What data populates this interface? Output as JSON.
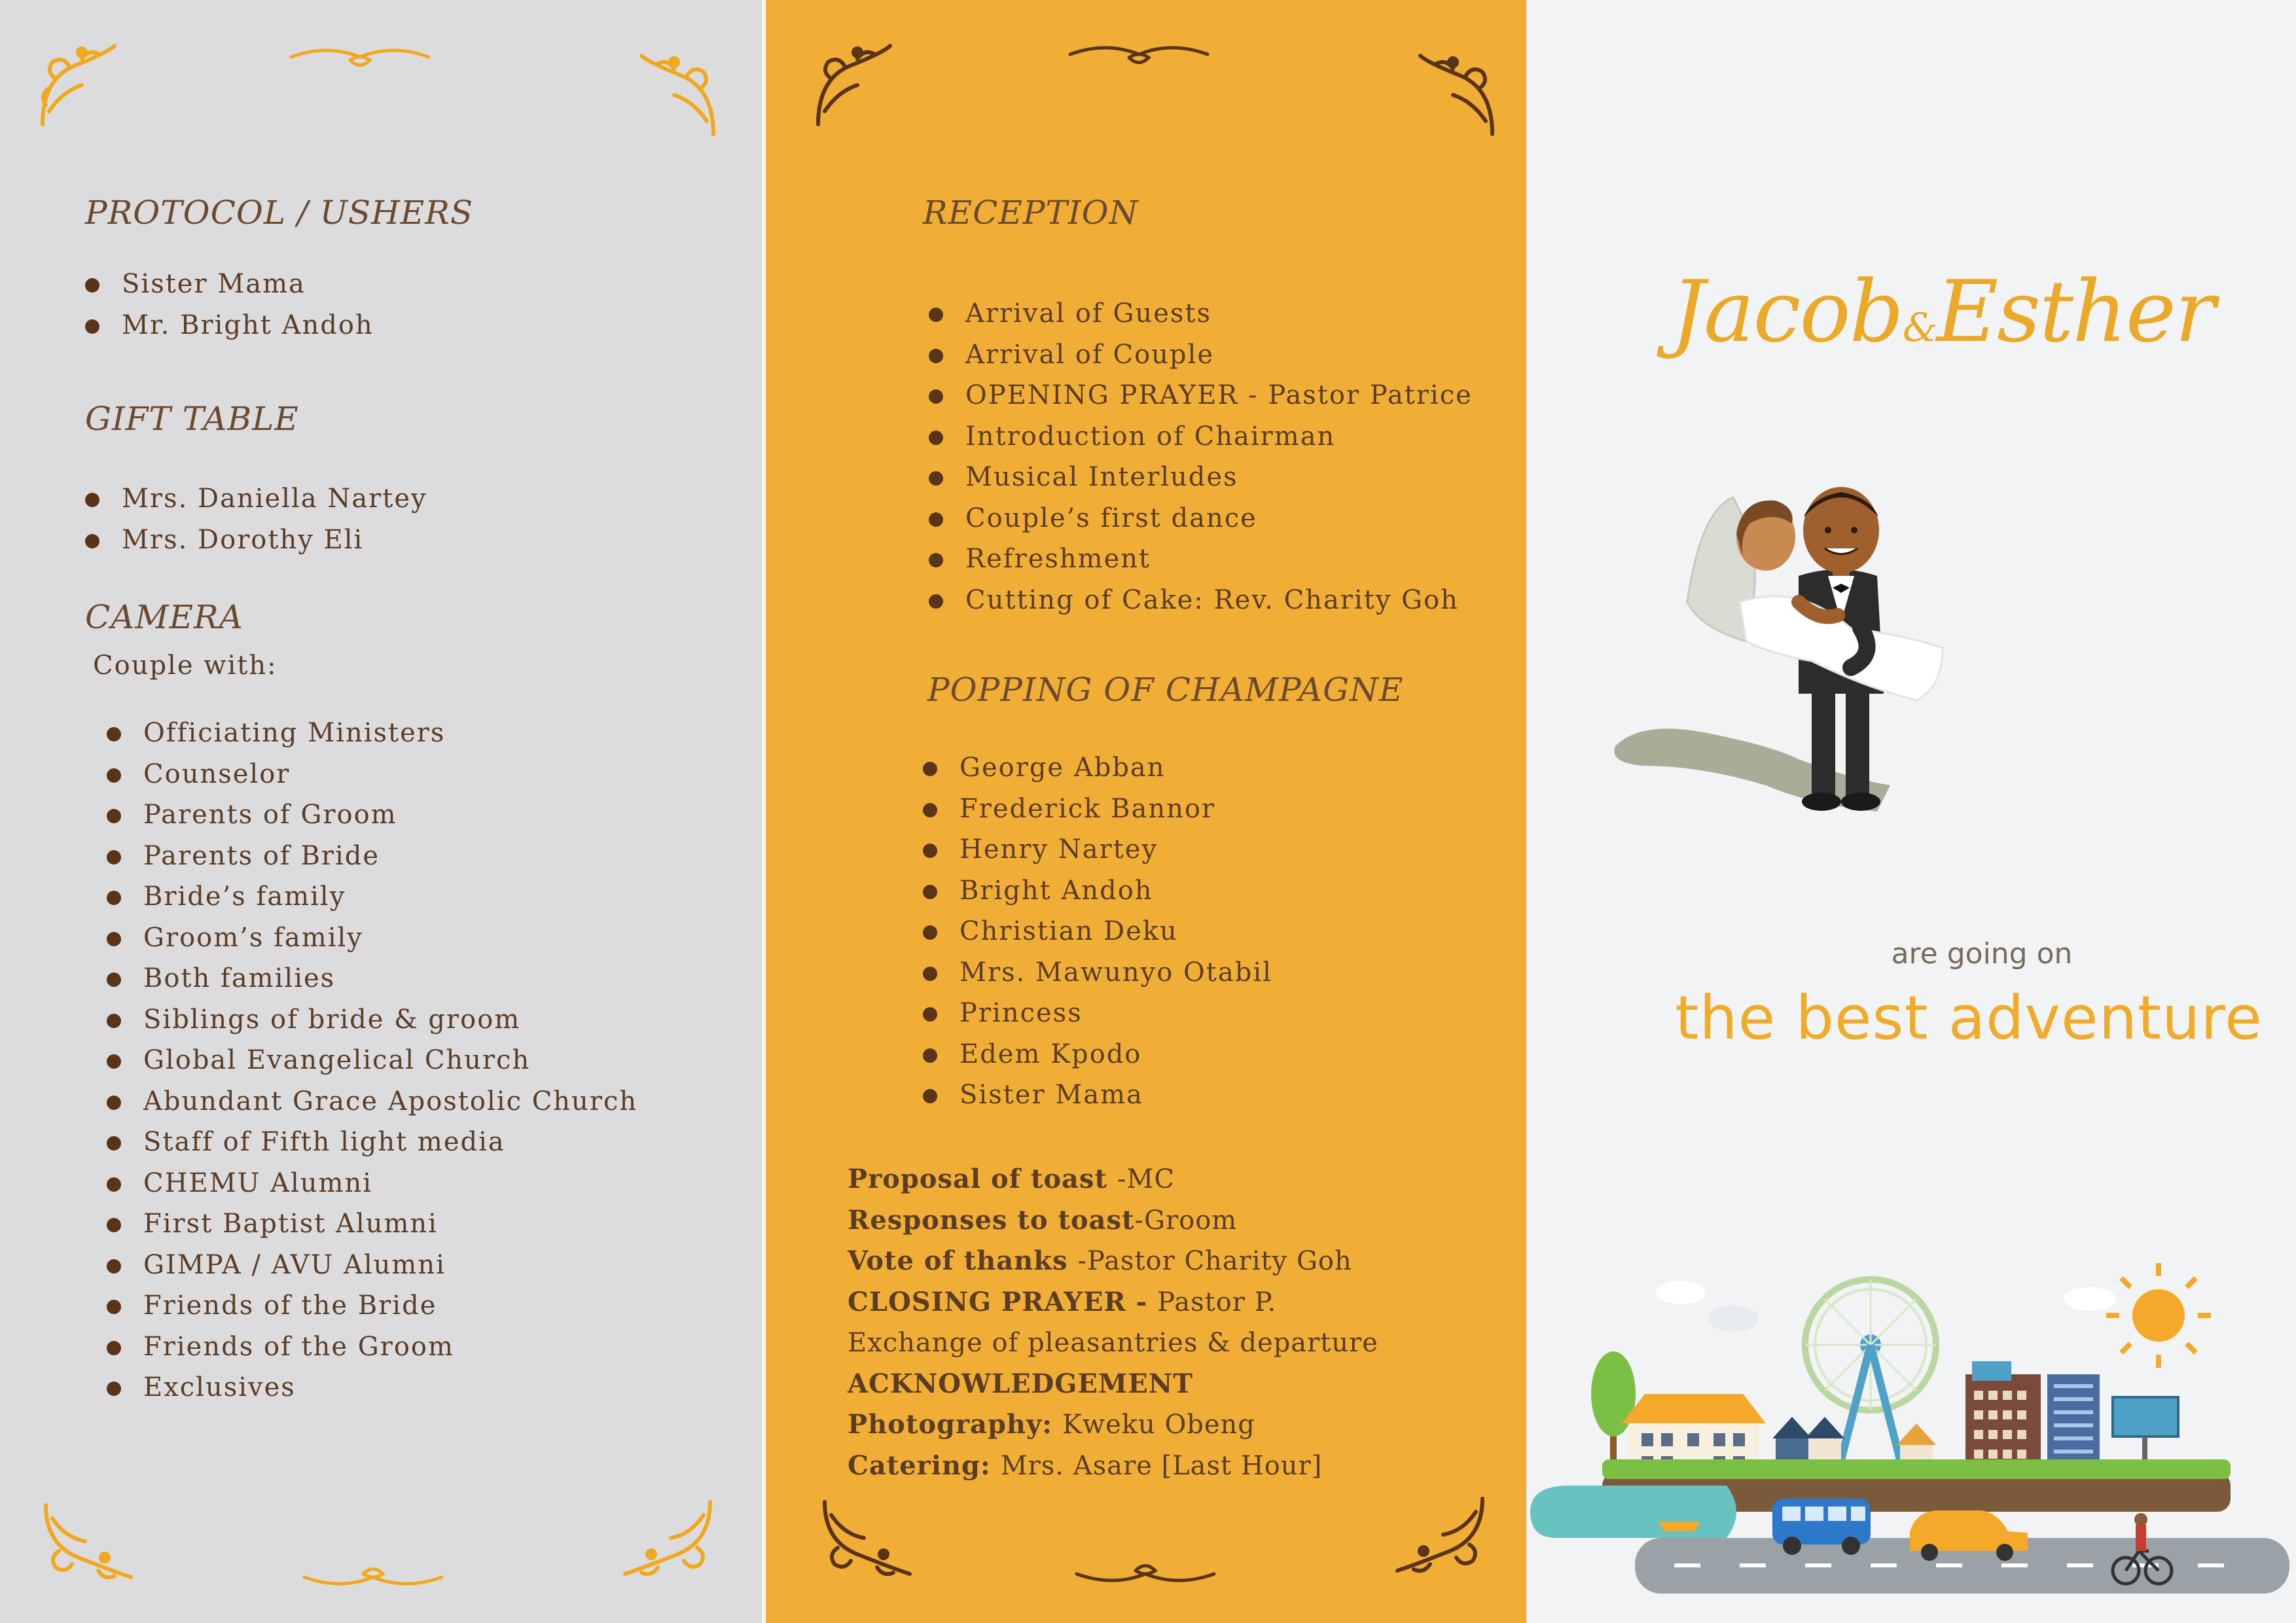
{
  "left_panel": {
    "protocol": {
      "heading": "PROTOCOL / USHERS",
      "items": [
        "Sister Mama",
        "Mr. Bright Andoh"
      ]
    },
    "gift_table": {
      "heading": "GIFT TABLE",
      "items": [
        "Mrs. Daniella Nartey",
        "Mrs. Dorothy Eli"
      ]
    },
    "camera": {
      "heading": "CAMERA",
      "subheading": "Couple with:",
      "items": [
        "Officiating Ministers",
        "Counselor",
        "Parents of Groom",
        "Parents of Bride",
        "Bride’s family",
        "Groom’s family",
        "Both families",
        "Siblings of bride & groom",
        "Global Evangelical Church",
        "Abundant Grace Apostolic Church",
        "Staff of Fifth light media",
        "CHEMU Alumni",
        "First Baptist Alumni",
        "GIMPA / AVU Alumni",
        "Friends of the Bride",
        "Friends of the Groom",
        "Exclusives"
      ]
    }
  },
  "middle_panel": {
    "reception": {
      "heading": "RECEPTION",
      "items": [
        "Arrival of Guests",
        "Arrival of Couple",
        "OPENING PRAYER - Pastor Patrice",
        "Introduction of Chairman",
        "Musical Interludes",
        "Couple’s first dance",
        "Refreshment",
        "Cutting of Cake: Rev. Charity Goh"
      ]
    },
    "champagne": {
      "heading": "POPPING OF CHAMPAGNE",
      "items": [
        "George Abban",
        "Frederick Bannor",
        "Henry Nartey",
        "Bright Andoh",
        "Christian Deku",
        "Mrs. Mawunyo Otabil",
        "Princess",
        "Edem Kpodo",
        "Sister Mama"
      ]
    },
    "closing": [
      {
        "bold": "Proposal of toast ",
        "text": "-MC"
      },
      {
        "bold": "Responses to toast",
        "text": "-Groom"
      },
      {
        "bold": "Vote of thanks ",
        "text": "-Pastor Charity Goh"
      },
      {
        "bold": "CLOSING PRAYER - ",
        "text": "Pastor P."
      },
      {
        "bold": "",
        "text": "Exchange of pleasantries & departure"
      },
      {
        "bold": "ACKNOWLEDGEMENT",
        "text": ""
      },
      {
        "bold": "Photography: ",
        "text": "Kweku Obeng"
      },
      {
        "bold": "Catering: ",
        "text": "Mrs. Asare [Last Hour]"
      }
    ]
  },
  "right_panel": {
    "name_first": "Jacob",
    "name_amp": "&",
    "name_second": "Esther",
    "tagline": "are going on",
    "headline": "the best adventure"
  },
  "colors": {
    "left_bg": "#dcdcde",
    "middle_bg": "#f1ae37",
    "right_bg": "#f2f3f4",
    "text_brown": "#5b3c24",
    "accent_orange": "#eba92a",
    "ornament_orange": "#f0a81e",
    "ornament_brown": "#5a3418"
  }
}
